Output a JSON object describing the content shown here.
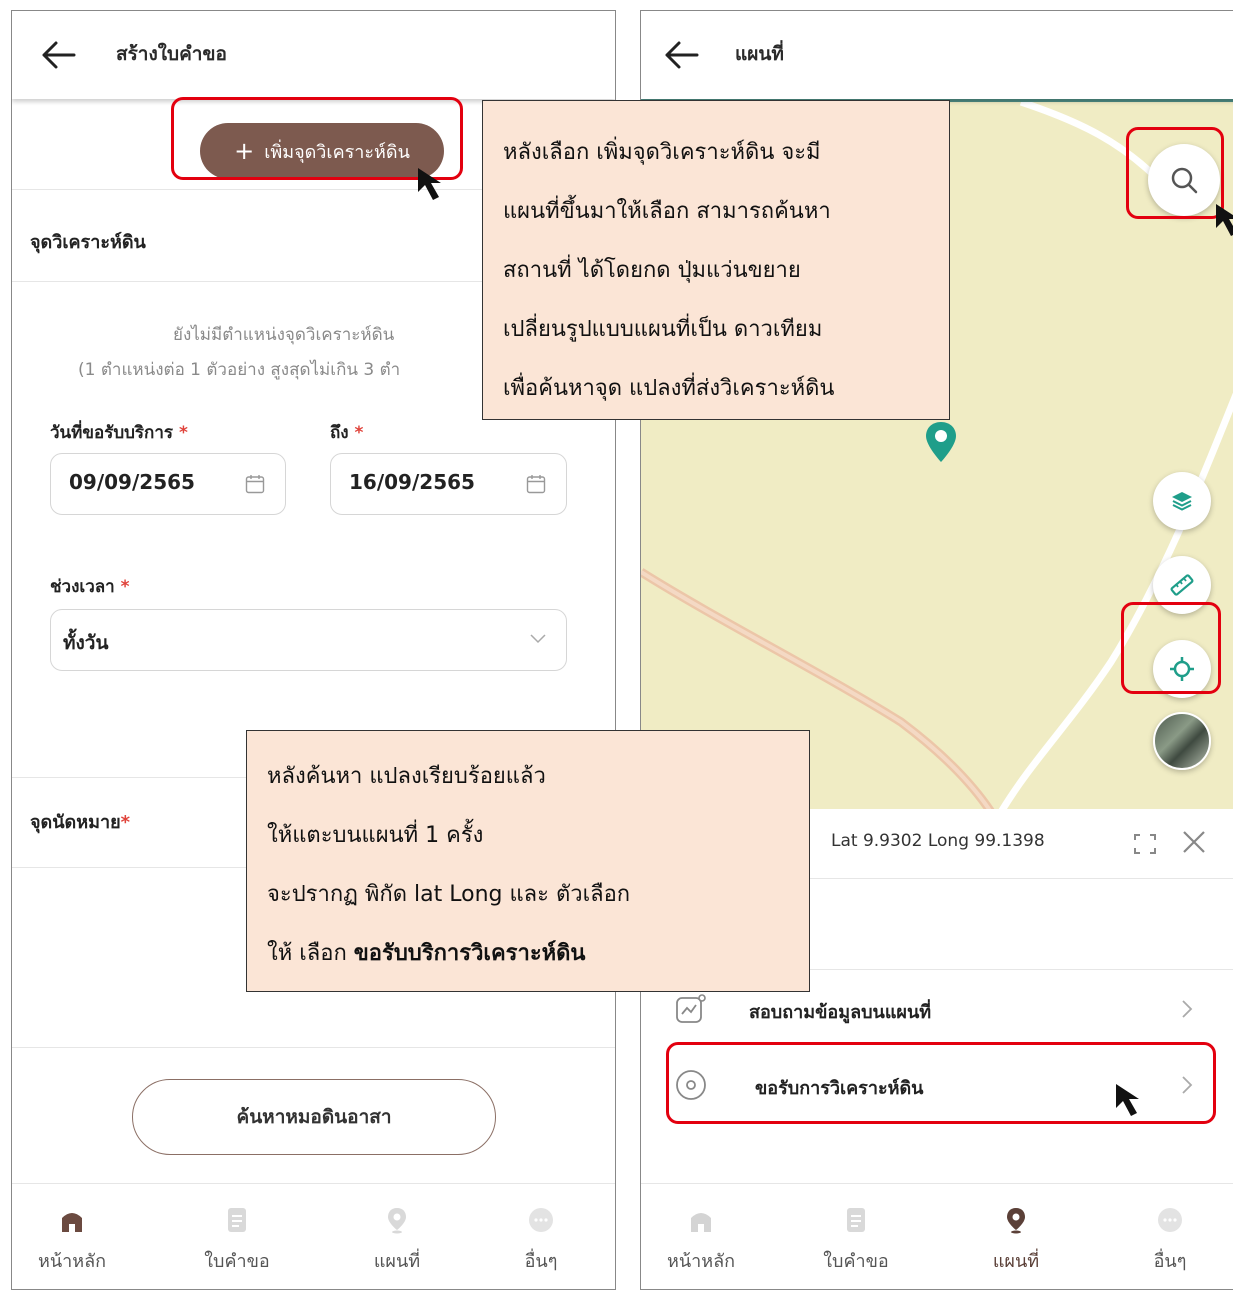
{
  "left_screen": {
    "title": "สร้างใบคำขอ",
    "add_button_label": "เพิ่มจุดวิเคราะห์ดิน",
    "section_analysis_title": "จุดวิเคราะห์ดิน",
    "empty_message_line1": "ยังไม่มีตำแหน่งจุดวิเคราะห์ดิน",
    "empty_message_line2": "(1 ตำแหน่งต่อ 1 ตัวอย่าง สูงสุดไม่เกิน 3 ตำ",
    "date_from_label": "วันที่ขอรับบริการ",
    "date_from_value": "09/09/2565",
    "date_to_label": "ถึง",
    "date_to_value": "16/09/2565",
    "time_label": "ช่วงเวลา",
    "time_value": "ทั้งวัน",
    "appointment_label": "จุดนัดหมาย",
    "required_mark": "*",
    "search_doctor_button": "ค้นหาหมอดินอาสา"
  },
  "right_screen": {
    "title": "แผนที่",
    "coordinates_text": "Lat 9.9302 Long 99.1398",
    "menu_items": [
      {
        "label": "สอบถามข้อมูลบนแผนที่",
        "icon": "chart-icon"
      },
      {
        "label": "ขอรับการวิเคราะห์ดิน",
        "icon": "location-pin-icon"
      }
    ]
  },
  "tabbar": {
    "items": [
      {
        "label": "หน้าหลัก",
        "icon": "home-icon"
      },
      {
        "label": "ใบคำขอ",
        "icon": "document-icon"
      },
      {
        "label": "แผนที่",
        "icon": "map-pin-icon"
      },
      {
        "label": "อื่นๆ",
        "icon": "more-icon"
      }
    ],
    "left_active": "",
    "right_active": "แผนที่"
  },
  "callouts": {
    "map_instructions": [
      "หลังเลือก เพิ่มจุดวิเคราะห์ดิน จะมี",
      "แผนที่ขึ้นมาให้เลือก สามารถค้นหา",
      "สถานที่ ได้โดยกด ปุ่มแว่นขยาย",
      "เปลี่ยนรูปแบบแผนที่เป็น ดาวเทียม",
      "เพื่อค้นหาจุด แปลงที่ส่งวิเคราะห์ดิน"
    ],
    "select_instructions": [
      "หลังค้นหา แปลงเรียบร้อยแล้ว",
      "ให้แตะบนแผนที่ 1 ครั้ง",
      "จะปรากฏ พิกัด lat Long และ ตัวเลือก"
    ],
    "select_final_prefix": "ให้ เลือก ",
    "select_final_bold": "ขอรับบริการวิเคราะห์ดิน"
  },
  "colors": {
    "brand_brown": "#7d5a4f",
    "highlight_red": "#e3000f",
    "callout_bg": "#fbe5d6",
    "map_bg": "#f0ecc4",
    "map_accent": "#1f9e8a",
    "required": "#e0433b"
  }
}
